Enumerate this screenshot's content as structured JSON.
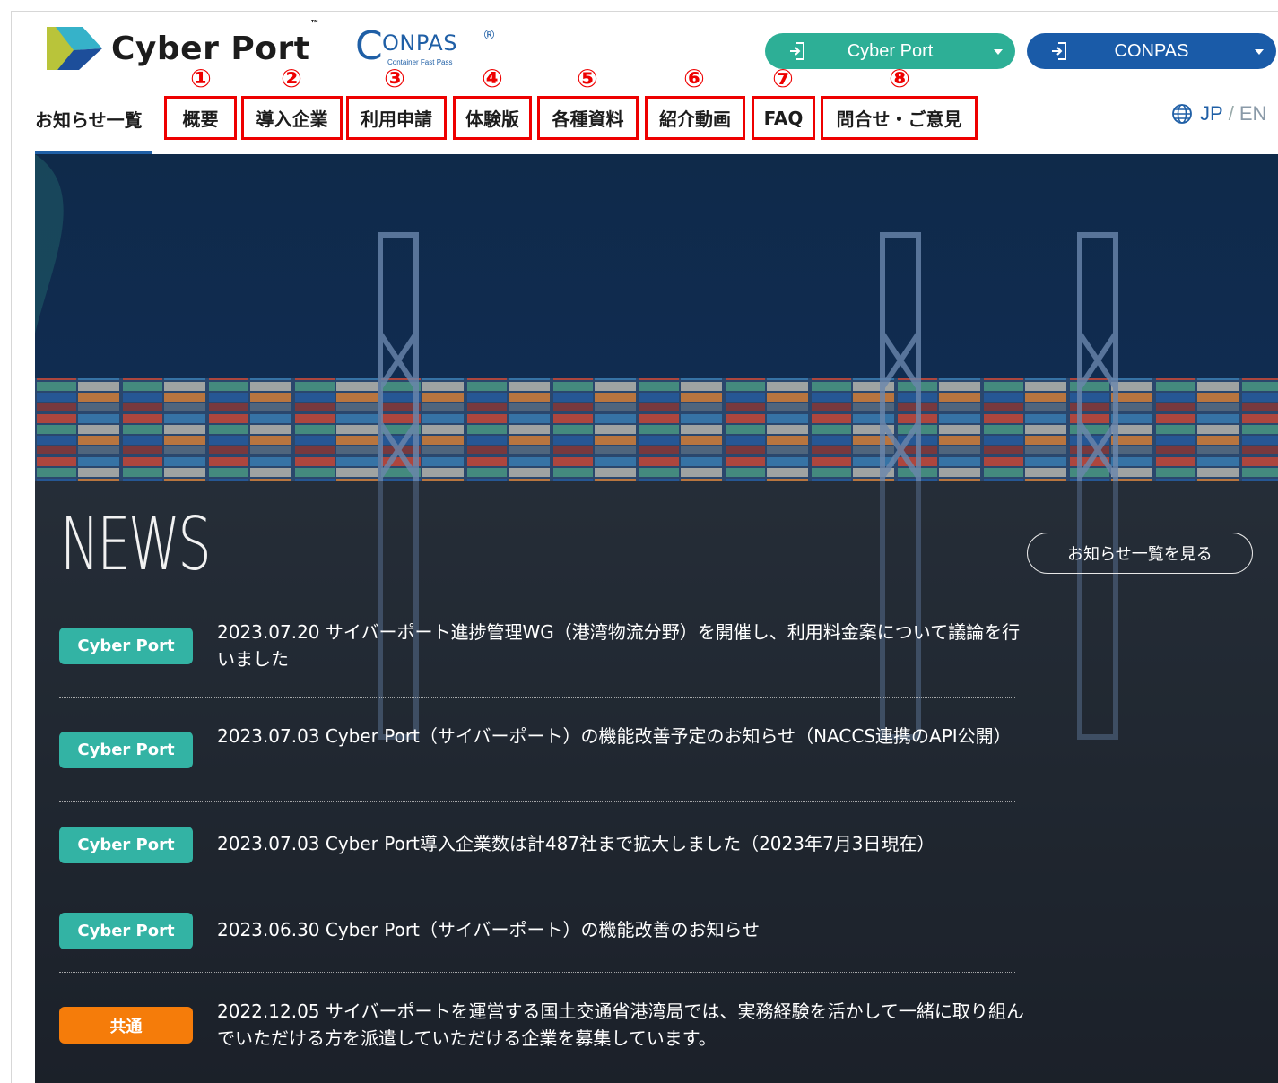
{
  "header": {
    "logo_text": "Cyber Port",
    "logo_tm": "™",
    "conpas_logo": {
      "c": "C",
      "main": "ONPAS",
      "reg": "®",
      "sub": "Container Fast Pass"
    },
    "login_buttons": [
      {
        "label": "Cyber Port",
        "icon": "login-icon",
        "color": "#2daf96"
      },
      {
        "label": "CONPAS",
        "icon": "login-icon",
        "color": "#1a5ba8"
      }
    ]
  },
  "nav": {
    "current": "お知らせ一覧",
    "items": [
      {
        "num": "①",
        "label": "概要"
      },
      {
        "num": "②",
        "label": "導入企業"
      },
      {
        "num": "③",
        "label": "利用申請"
      },
      {
        "num": "④",
        "label": "体験版"
      },
      {
        "num": "⑤",
        "label": "各種資料"
      },
      {
        "num": "⑥",
        "label": "紹介動画"
      },
      {
        "num": "⑦",
        "label": "FAQ"
      },
      {
        "num": "⑧",
        "label": "問合せ・ご意見"
      }
    ],
    "highlight_color": "#ee0000"
  },
  "lang": {
    "icon": "globe-icon",
    "jp": "JP",
    "separator": "/",
    "en": "EN"
  },
  "news": {
    "title": "NEWS",
    "list_button": "お知らせ一覧を見る",
    "items": [
      {
        "tag": "Cyber Port",
        "text": "2023.07.20 サイバーポート進捗管理WG（港湾物流分野）を開催し、利用料金案について議論を行いました"
      },
      {
        "tag": "Cyber Port",
        "text": "2023.07.03 Cyber Port（サイバーポート）の機能改善予定のお知らせ（NACCS連携のAPI公開）"
      },
      {
        "tag": "Cyber Port",
        "text": "2023.07.03 Cyber Port導入企業数は計487社まで拡大しました（2023年7月3日現在）"
      },
      {
        "tag": "Cyber Port",
        "text": "2023.06.30 Cyber Port（サイバーポート）の機能改善のお知らせ"
      },
      {
        "tag": "共通",
        "text": "2022.12.05 サイバーポートを運営する国土交通省港湾局では、実務経験を活かして一緒に取り組んでいただける方を派遣していただける企業を募集しています。"
      }
    ],
    "tag_colors": {
      "cyber": "#33b3a4",
      "common": "#f57c0a"
    }
  }
}
